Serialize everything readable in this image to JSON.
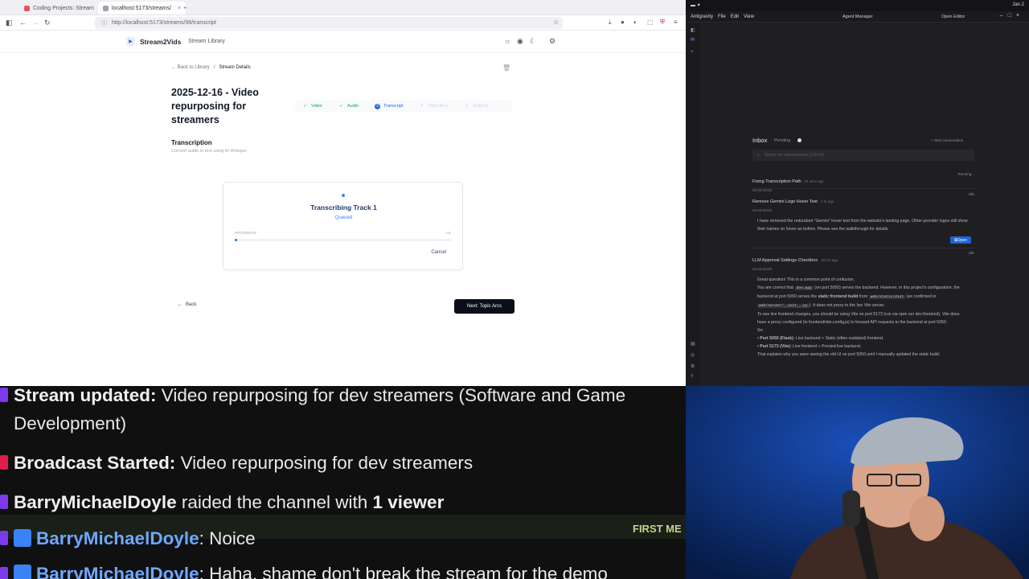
{
  "browser": {
    "tabs": [
      {
        "label": "Coding Projects: Stream"
      },
      {
        "label": "localhost:5173/streams/"
      }
    ],
    "url": "http://localhost:5173/streams/98/transcript"
  },
  "app": {
    "brand": "Stream2Vids",
    "nav_library": "Stream Library",
    "breadcrumb_back": "Back to Library",
    "breadcrumb_current": "Stream Details",
    "page_title": "2025-12-16 - Video repurposing for streamers",
    "steps": [
      {
        "label": "Video",
        "state": "done",
        "marker": "✓"
      },
      {
        "label": "Audio",
        "state": "done",
        "marker": "✓"
      },
      {
        "label": "Transcript",
        "state": "active",
        "marker": "3"
      },
      {
        "label": "Topic Arcs",
        "state": "todo",
        "marker": "4"
      },
      {
        "label": "Outputs",
        "state": "todo",
        "marker": "5"
      }
    ],
    "section_title": "Transcription",
    "section_subtitle": "Convert audio to text using AI Whisper.",
    "card": {
      "title": "Transcribing Track 1",
      "status": "Queued",
      "progress_label": "PROGRESS",
      "progress_text": "1%",
      "progress_value": 0.01,
      "cancel_label": "Cancel"
    },
    "back_label": "Back",
    "next_label": "Next: Topic Arcs",
    "accent": "#2563eb"
  },
  "antigravity": {
    "menu": [
      "Antigravity",
      "File",
      "Edit",
      "View"
    ],
    "manager_label": "Agent Manager",
    "editor_label": "Open Editor",
    "date": "Jan 2",
    "inbox_label": "Inbox",
    "pending_label": "Pending",
    "start_label": "+ Start conversation",
    "search_placeholder": "Search for conversations (Ctrl+K)",
    "conversations": [
      {
        "title": "Fixing Transcription Path",
        "time": "54 secs ago",
        "project": "stream2vids",
        "state": "Running..."
      },
      {
        "title": "Remove Gemini Logo Hover Text",
        "time": "1 hr ago",
        "project": "stream2vids",
        "state": "Idle",
        "body": "I have removed the redundant \"Gemini\" hover text from the website's landing page. Other provider logos still show their names on hover as before. Please see the walkthrough for details.",
        "open_label": "Open"
      },
      {
        "title": "LLM Approval Settings Checkbox",
        "time": "18 hrs ago",
        "project": "stream2vids",
        "state": "Idle",
        "body_1": "Great question! This is a common point of confusion.",
        "body_2a": "You are correct that ",
        "body_2code": "dev:app",
        "body_2b": " (on port 5050) serves the backend. However, in this project's configuration, the backend at port 5050 serves the ",
        "body_2bold": "static frontend build",
        "body_2c": " from ",
        "body_2code2": "web/static/dist",
        "body_2d": " (as confirmed in ",
        "body_2code3": "web/server/__init__.py",
        "body_2e": "). It does not proxy to the live Vite server.",
        "body_3": "To see live frontend changes, you should be using Vite on port 5173 (run via npm run dev:frontend). Vite does have a proxy configured (in frontend/vite.config.js) to forward API requests to the backend at port 5050.",
        "body_4": "So:",
        "bullet_1a": "Port 5050 (Flask):",
        "bullet_1b": " Live backend + Static (often outdated) frontend.",
        "bullet_2a": "Port 5173 (Vite):",
        "bullet_2b": " Live frontend + Proxied live backend.",
        "body_5": "That explains why you were seeing the old UI on port 5050 until I manually updated the static build."
      }
    ]
  },
  "chat": {
    "l1_bold": "Stream updated:",
    "l1_text": " Video repurposing for dev streamers (Software and Game",
    "l1_cont": "Development)",
    "l2_bold": "Broadcast Started:",
    "l2_text": " Video repurposing for dev streamers",
    "l3_bold": "BarryMichaelDoyle",
    "l3_text": " raided the channel with ",
    "l3_bold2": "1 viewer",
    "l4_user": "BarryMichaelDoyle",
    "l4_text": ": Noice",
    "l4_badge": "FIRST ME",
    "l5_user": "BarryMichaelDoyle",
    "l5_text": ": Haha, shame don't break the stream for the demo"
  }
}
